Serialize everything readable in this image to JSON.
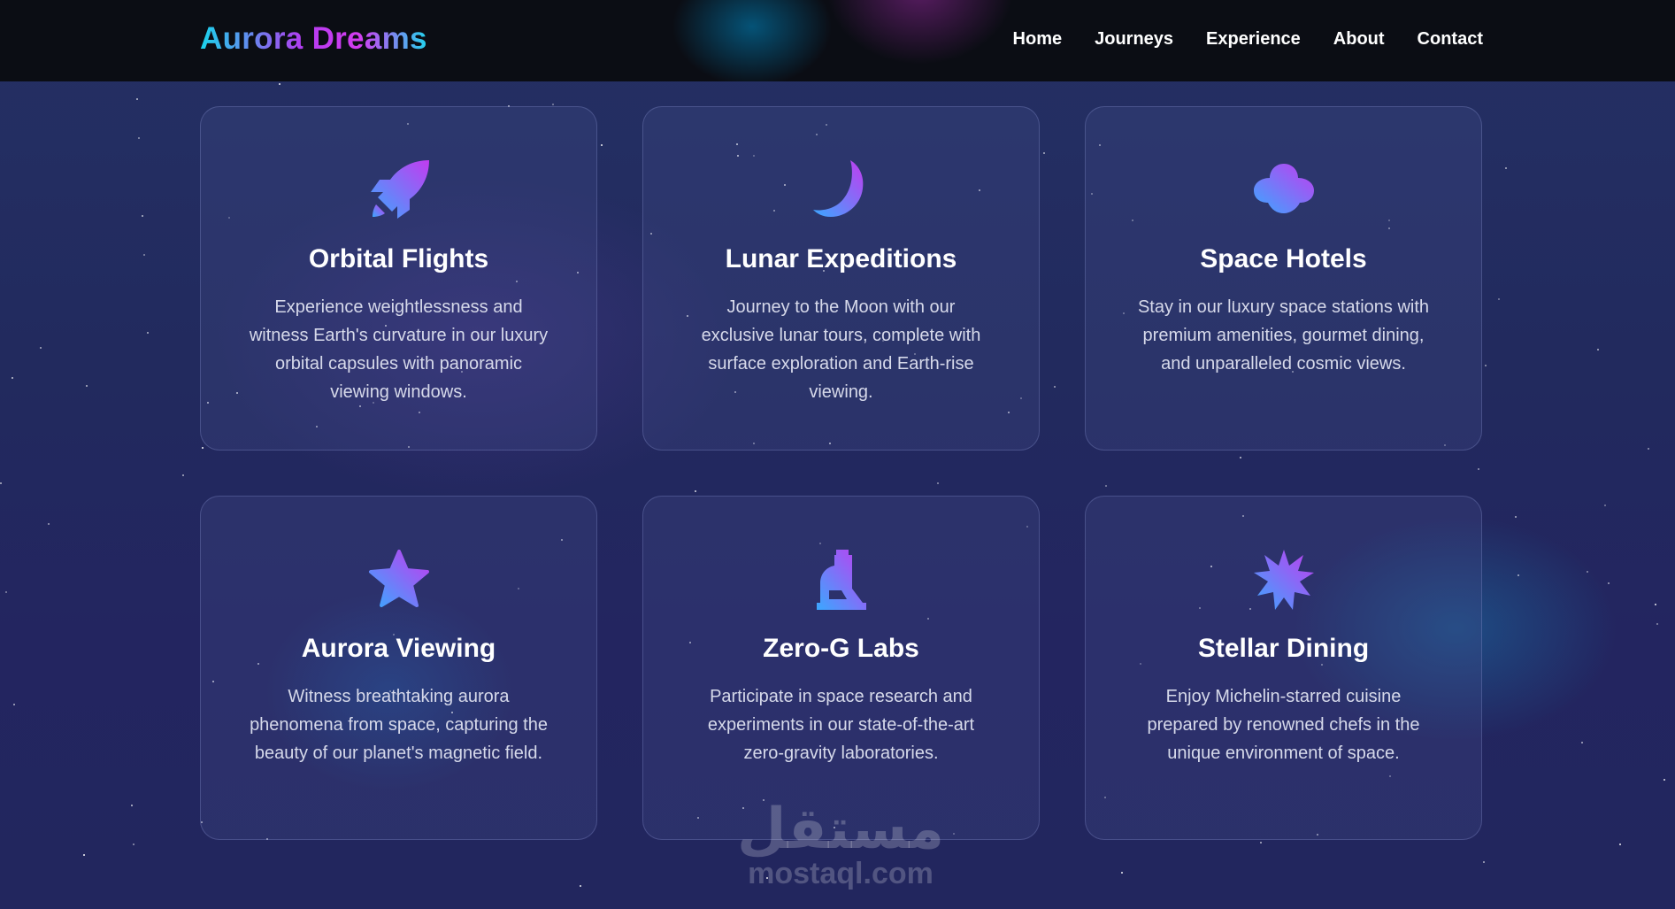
{
  "header": {
    "brand": "Aurora Dreams",
    "nav": [
      "Home",
      "Journeys",
      "Experience",
      "About",
      "Contact"
    ]
  },
  "cards": [
    {
      "icon": "rocket-icon",
      "title": "Orbital Flights",
      "desc": "Experience weightlessness and witness Earth's curvature in our luxury orbital capsules with panoramic viewing windows."
    },
    {
      "icon": "moon-icon",
      "title": "Lunar Expeditions",
      "desc": "Journey to the Moon with our exclusive lunar tours, complete with surface exploration and Earth-rise viewing."
    },
    {
      "icon": "cloud-icon",
      "title": "Space Hotels",
      "desc": "Stay in our luxury space stations with premium amenities, gourmet dining, and unparalleled cosmic views."
    },
    {
      "icon": "star-icon",
      "title": "Aurora Viewing",
      "desc": "Witness breathtaking aurora phenomena from space, capturing the beauty of our planet's magnetic field."
    },
    {
      "icon": "microscope-icon",
      "title": "Zero-G Labs",
      "desc": "Participate in space research and experiments in our state-of-the-art zero-gravity laboratories."
    },
    {
      "icon": "burst-icon",
      "title": "Stellar Dining",
      "desc": "Enjoy Michelin-starred cuisine prepared by renowned chefs in the unique environment of space."
    }
  ],
  "watermark": {
    "arabic": "مستقل",
    "latin": "mostaql.com"
  },
  "colors": {
    "icon_gradient_start": "#3aa8ff",
    "icon_gradient_end": "#c23cf0",
    "brand_cyan": "#19d4ec",
    "brand_magenta": "#d43cf0"
  }
}
